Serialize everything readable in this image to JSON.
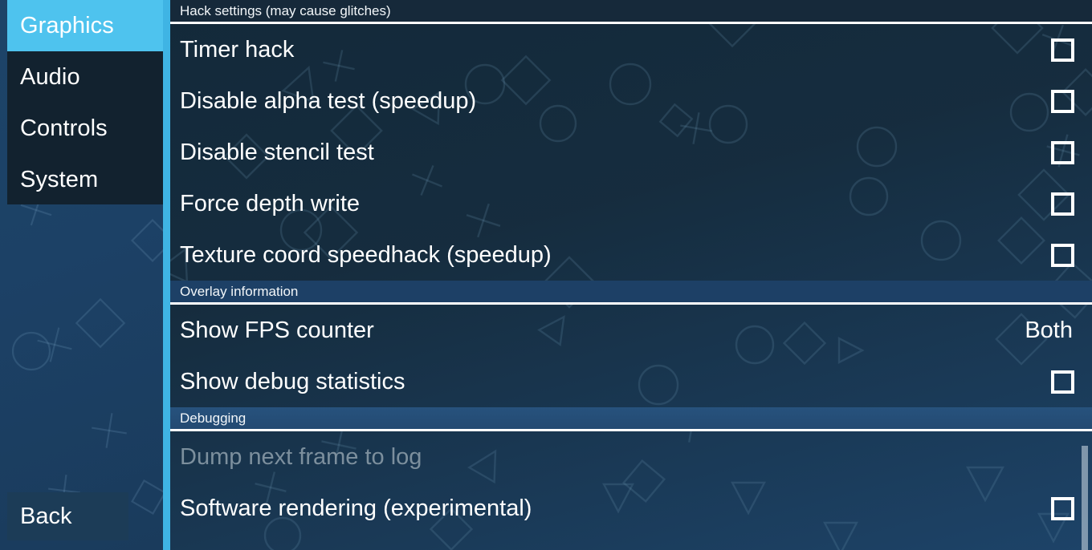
{
  "sidebar": {
    "nav_items": [
      {
        "label": "Graphics",
        "selected": true
      },
      {
        "label": "Audio",
        "selected": false
      },
      {
        "label": "Controls",
        "selected": false
      },
      {
        "label": "System",
        "selected": false
      }
    ],
    "back_label": "Back"
  },
  "colors": {
    "accent_cyan": "#3fb4e4",
    "selected_nav": "#4ec3ee",
    "panel_dark": "#16293a",
    "header_mid": "#1d4066",
    "header_light": "#27527d",
    "text": "#ffffff",
    "text_disabled": "#7c8f9d"
  },
  "sections": [
    {
      "title": "Hack settings (may cause glitches)",
      "style": "dark",
      "rows": [
        {
          "label": "Timer hack",
          "control": "checkbox",
          "checked": false,
          "disabled": false
        },
        {
          "label": "Disable alpha test (speedup)",
          "control": "checkbox",
          "checked": false,
          "disabled": false
        },
        {
          "label": "Disable stencil test",
          "control": "checkbox",
          "checked": false,
          "disabled": false
        },
        {
          "label": "Force depth write",
          "control": "checkbox",
          "checked": false,
          "disabled": false
        },
        {
          "label": "Texture coord speedhack (speedup)",
          "control": "checkbox",
          "checked": false,
          "disabled": false
        }
      ]
    },
    {
      "title": "Overlay information",
      "style": "mid",
      "rows": [
        {
          "label": "Show FPS counter",
          "control": "value",
          "value": "Both",
          "disabled": false
        },
        {
          "label": "Show debug statistics",
          "control": "checkbox",
          "checked": false,
          "disabled": false
        }
      ]
    },
    {
      "title": "Debugging",
      "style": "light",
      "rows": [
        {
          "label": "Dump next frame to log",
          "control": "none",
          "disabled": true
        },
        {
          "label": "Software rendering (experimental)",
          "control": "checkbox",
          "checked": false,
          "disabled": false
        }
      ]
    }
  ],
  "scrollbar": {
    "visible": true
  }
}
